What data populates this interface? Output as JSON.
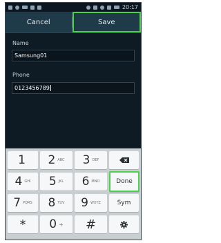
{
  "status_bar": {
    "time": "20:17"
  },
  "action_bar": {
    "cancel_label": "Cancel",
    "save_label": "Save"
  },
  "form": {
    "name_label": "Name",
    "name_value": "Samsung01",
    "phone_label": "Phone",
    "phone_value": "0123456789"
  },
  "keyboard": {
    "rows": [
      [
        {
          "num": "1",
          "letters": ""
        },
        {
          "num": "2",
          "letters": "ABC"
        },
        {
          "num": "3",
          "letters": "DEF"
        }
      ],
      [
        {
          "num": "4",
          "letters": "GHI"
        },
        {
          "num": "5",
          "letters": "JKL"
        },
        {
          "num": "6",
          "letters": "MNO"
        }
      ],
      [
        {
          "num": "7",
          "letters": "PQRS"
        },
        {
          "num": "8",
          "letters": "TUV"
        },
        {
          "num": "9",
          "letters": "WXYZ"
        }
      ]
    ],
    "done_label": "Done",
    "sym_label": "Sym",
    "star_label": "*",
    "zero_label": "0",
    "zero_sub": "+",
    "hash_label": "#",
    "backspace_icon": "backspace-icon",
    "settings_icon": "gear-icon"
  },
  "colors": {
    "highlight": "#4bd14b",
    "action_bar": "#1f3a48",
    "background": "#0e1a24",
    "keyboard_bg": "#c9ced1"
  }
}
